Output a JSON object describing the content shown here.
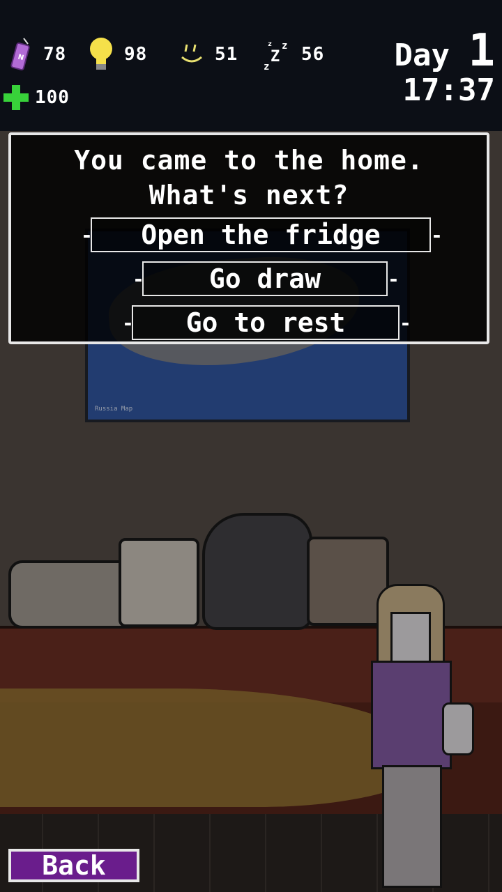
{
  "stats": [
    {
      "name": "energy-drink-icon",
      "value": "78",
      "color": "#b26bd6"
    },
    {
      "name": "lightbulb-icon",
      "value": "98",
      "color": "#f5e04a"
    },
    {
      "name": "smile-icon",
      "value": "51",
      "color": "#e8e070"
    },
    {
      "name": "sleep-icon",
      "value": "56",
      "color": "#ffffff"
    },
    {
      "name": "health-cross-icon",
      "value": "100",
      "color": "#38d23a"
    }
  ],
  "day": {
    "label": "Day",
    "number": "1",
    "time": "17:37"
  },
  "dialog": {
    "line1": "You came to the home.",
    "line2": "What's next?",
    "choices": [
      "Open the fridge",
      "Go draw",
      "Go to rest"
    ]
  },
  "back_label": "Back",
  "map_caption": "Russia Map"
}
